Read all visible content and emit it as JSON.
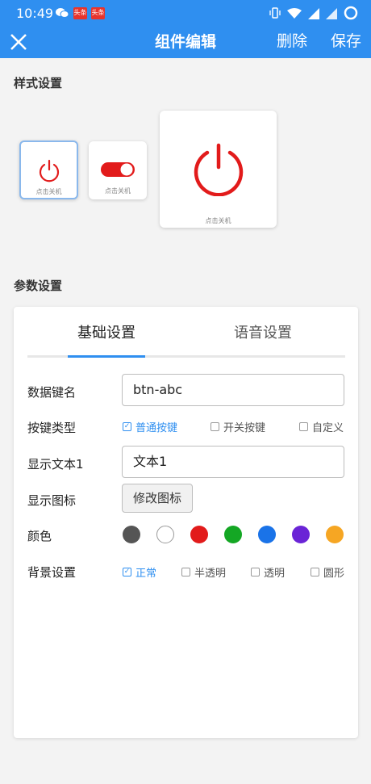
{
  "status_bar": {
    "time": "10:49",
    "badge1": "头条",
    "badge2": "头条"
  },
  "header": {
    "title": "组件编辑",
    "delete_label": "删除",
    "save_label": "保存"
  },
  "style_section": {
    "title": "样式设置",
    "cards": [
      {
        "caption": "点击关机",
        "icon": "power-icon"
      },
      {
        "caption": "点击关机",
        "icon": "toggle-switch-icon"
      },
      {
        "caption": "点击关机",
        "icon": "power-icon"
      }
    ]
  },
  "param_section": {
    "title": "参数设置",
    "tabs": [
      {
        "label": "基础设置"
      },
      {
        "label": "语音设置"
      }
    ],
    "fields": {
      "data_key": {
        "label": "数据键名",
        "value": "btn-abc"
      },
      "key_type": {
        "label": "按键类型",
        "options": [
          {
            "label": "普通按键",
            "checked": true
          },
          {
            "label": "开关按键",
            "checked": false
          },
          {
            "label": "自定义",
            "checked": false
          }
        ]
      },
      "display_text": {
        "label": "显示文本1",
        "value": "文本1"
      },
      "display_icon": {
        "label": "显示图标",
        "button": "修改图标"
      },
      "color": {
        "label": "颜色",
        "swatches": [
          "#555555",
          "#ffffff",
          "#e21b1b",
          "#14a724",
          "#1a73e8",
          "#6a24d6",
          "#f6a623"
        ]
      },
      "background": {
        "label": "背景设置",
        "options": [
          {
            "label": "正常",
            "checked": true
          },
          {
            "label": "半透明",
            "checked": false
          },
          {
            "label": "透明",
            "checked": false
          },
          {
            "label": "圆形",
            "checked": false
          }
        ]
      }
    }
  },
  "colors": {
    "primary": "#2f8ff0",
    "power_red": "#e21b1b"
  }
}
